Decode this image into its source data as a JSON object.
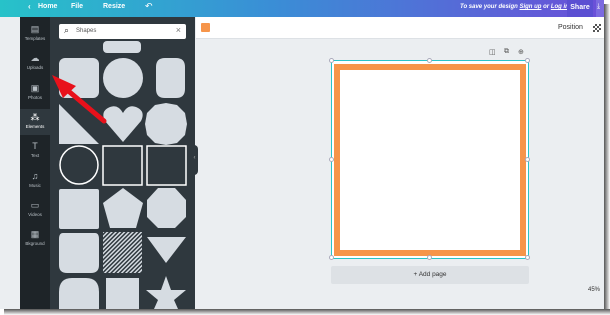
{
  "topbar": {
    "home": "Home",
    "file": "File",
    "resize": "Resize",
    "save_msg_prefix": "To save your design ",
    "sign_up": "Sign up",
    "or": " or ",
    "log_in": "Log in",
    "share": "Share"
  },
  "rail": {
    "items": [
      {
        "label": "Templates",
        "icon": "template-icon"
      },
      {
        "label": "Uploads",
        "icon": "upload-cloud-icon"
      },
      {
        "label": "Photos",
        "icon": "photo-icon"
      },
      {
        "label": "Elements",
        "icon": "elements-icon"
      },
      {
        "label": "Text",
        "icon": "text-icon"
      },
      {
        "label": "Music",
        "icon": "music-icon"
      },
      {
        "label": "Videos",
        "icon": "video-icon"
      },
      {
        "label": "Bkground",
        "icon": "background-icon"
      }
    ]
  },
  "search": {
    "placeholder": "Shapes"
  },
  "toolbar": {
    "color": "#f6954a",
    "position": "Position"
  },
  "editor": {
    "add_page": "+ Add page",
    "zoom": "45%"
  },
  "colors": {
    "accent": "#f6954a",
    "selection": "#29c3c9",
    "annotation_arrow": "#e8111b"
  }
}
